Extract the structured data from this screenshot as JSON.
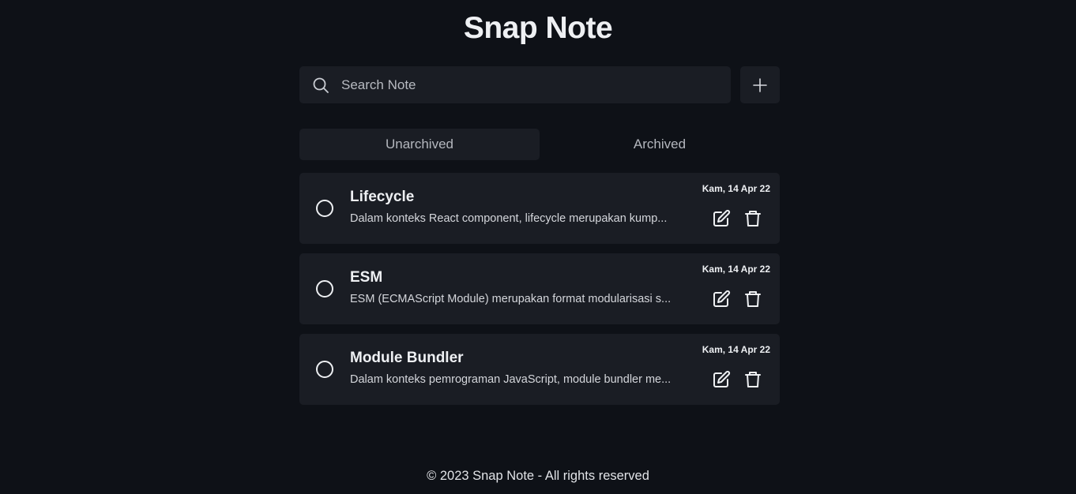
{
  "header": {
    "title": "Snap Note"
  },
  "search": {
    "placeholder": "Search Note",
    "value": "",
    "icon": "search-icon"
  },
  "toolbar": {
    "add_icon": "plus-icon"
  },
  "tabs": [
    {
      "label": "Unarchived",
      "active": true
    },
    {
      "label": "Archived",
      "active": false
    }
  ],
  "notes": [
    {
      "title": "Lifecycle",
      "body": "Dalam konteks React component, lifecycle merupakan kump...",
      "date": "Kam, 14 Apr 22"
    },
    {
      "title": "ESM",
      "body": "ESM (ECMAScript Module) merupakan format modularisasi s...",
      "date": "Kam, 14 Apr 22"
    },
    {
      "title": "Module Bundler",
      "body": "Dalam konteks pemrograman JavaScript, module bundler me...",
      "date": "Kam, 14 Apr 22"
    }
  ],
  "footer": {
    "text": "© 2023 Snap Note - All rights reserved"
  },
  "colors": {
    "background": "#0e1117",
    "card": "#1a1d24",
    "text": "#eef0f3"
  }
}
